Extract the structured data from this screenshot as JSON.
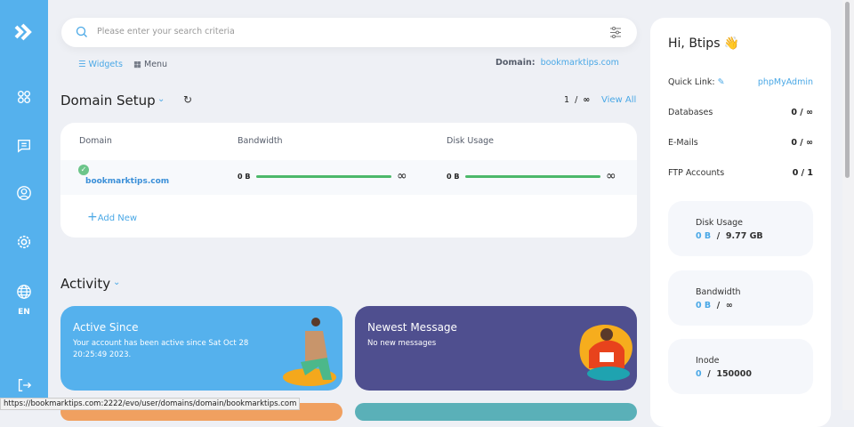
{
  "sidebar": {
    "items": [
      "logo",
      "apps",
      "messages",
      "profile",
      "settings",
      "language"
    ],
    "language": "EN"
  },
  "search": {
    "placeholder": "Please enter your search criteria"
  },
  "view_toggle": {
    "widgets": "Widgets",
    "menu": "Menu"
  },
  "domain_label": "Domain:",
  "domain_value": "bookmarktips.com",
  "domain_setup": {
    "title": "Domain Setup",
    "count": "1",
    "separator": "/",
    "limit": "∞",
    "view_all": "View All",
    "columns": [
      "Domain",
      "Bandwidth",
      "Disk Usage"
    ],
    "rows": [
      {
        "domain": "bookmarktips.com",
        "bandwidth": "0 B",
        "bandwidth_limit": "∞",
        "bandwidth_fill": 1.0,
        "disk": "0 B",
        "disk_limit": "∞",
        "disk_fill": 1.0
      }
    ],
    "add_new": "Add New"
  },
  "activity": {
    "title": "Activity",
    "cards": [
      {
        "title": "Active Since",
        "text": "Your account has been active since Sat Oct 28 20:25:49 2023.",
        "color": "#55b1ed"
      },
      {
        "title": "Newest Message",
        "text": "No new messages",
        "color": "#4f4f8f"
      }
    ]
  },
  "panel": {
    "greeting": "Hi, Btips 👋",
    "quick_link_label": "Quick Link:",
    "quick_link": "phpMyAdmin",
    "stats": [
      {
        "label": "Databases",
        "value": "0 / ∞"
      },
      {
        "label": "E-Mails",
        "value": "0 / ∞"
      },
      {
        "label": "FTP Accounts",
        "value": "0 / 1"
      }
    ],
    "usage": [
      {
        "label": "Disk Usage",
        "used": "0 B",
        "total": "9.77 GB"
      },
      {
        "label": "Bandwidth",
        "used": "0 B",
        "total": "∞"
      },
      {
        "label": "Inode",
        "used": "0",
        "total": "150000"
      }
    ]
  },
  "status_url": "https://bookmarktips.com:2222/evo/user/domains/domain/bookmarktips.com"
}
